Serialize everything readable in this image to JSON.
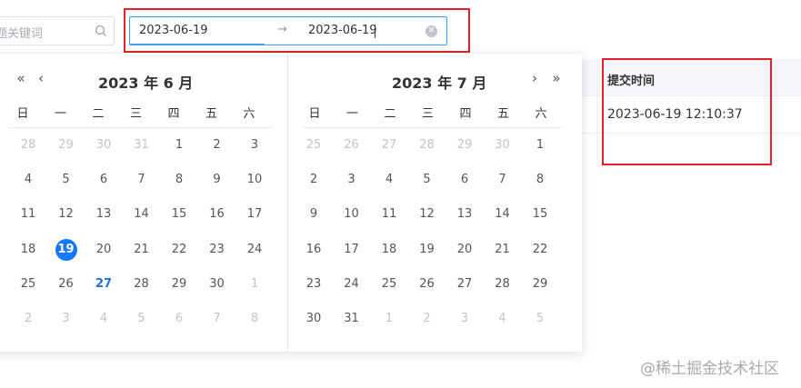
{
  "search": {
    "placeholder": "题关键词"
  },
  "date_range": {
    "start": "2023-06-19",
    "separator": "→",
    "end": "2023-06-19"
  },
  "calendar": {
    "left": {
      "title": "2023 年 6 月",
      "nav_prev_year": "«",
      "nav_prev_month": "‹",
      "weekdays": [
        "日",
        "一",
        "二",
        "三",
        "四",
        "五",
        "六"
      ],
      "weeks": [
        [
          "28",
          "29",
          "30",
          "31",
          "1",
          "2",
          "3"
        ],
        [
          "4",
          "5",
          "6",
          "7",
          "8",
          "9",
          "10"
        ],
        [
          "11",
          "12",
          "13",
          "14",
          "15",
          "16",
          "17"
        ],
        [
          "18",
          "19",
          "20",
          "21",
          "22",
          "23",
          "24"
        ],
        [
          "25",
          "26",
          "27",
          "28",
          "29",
          "30",
          "1"
        ],
        [
          "2",
          "3",
          "4",
          "5",
          "6",
          "7",
          "8"
        ]
      ],
      "selected_day": "19",
      "today_day": "27"
    },
    "right": {
      "title": "2023 年 7 月",
      "nav_next_month": "›",
      "nav_next_year": "»",
      "weekdays": [
        "日",
        "一",
        "二",
        "三",
        "四",
        "五",
        "六"
      ],
      "weeks": [
        [
          "25",
          "26",
          "27",
          "28",
          "29",
          "30",
          "1"
        ],
        [
          "2",
          "3",
          "4",
          "5",
          "6",
          "7",
          "8"
        ],
        [
          "9",
          "10",
          "11",
          "12",
          "13",
          "14",
          "15"
        ],
        [
          "16",
          "17",
          "18",
          "19",
          "20",
          "21",
          "22"
        ],
        [
          "23",
          "24",
          "25",
          "26",
          "27",
          "28",
          "29"
        ],
        [
          "30",
          "31",
          "1",
          "2",
          "3",
          "4",
          "5"
        ]
      ]
    }
  },
  "table": {
    "column_header": "提交时间",
    "rows": [
      {
        "submit_time": "2023-06-19 12:10:37"
      }
    ]
  },
  "watermark": "@稀土掘金技术社区",
  "colors": {
    "accent": "#409eff",
    "selected": "#1677ff",
    "annotation": "#e0202a"
  }
}
